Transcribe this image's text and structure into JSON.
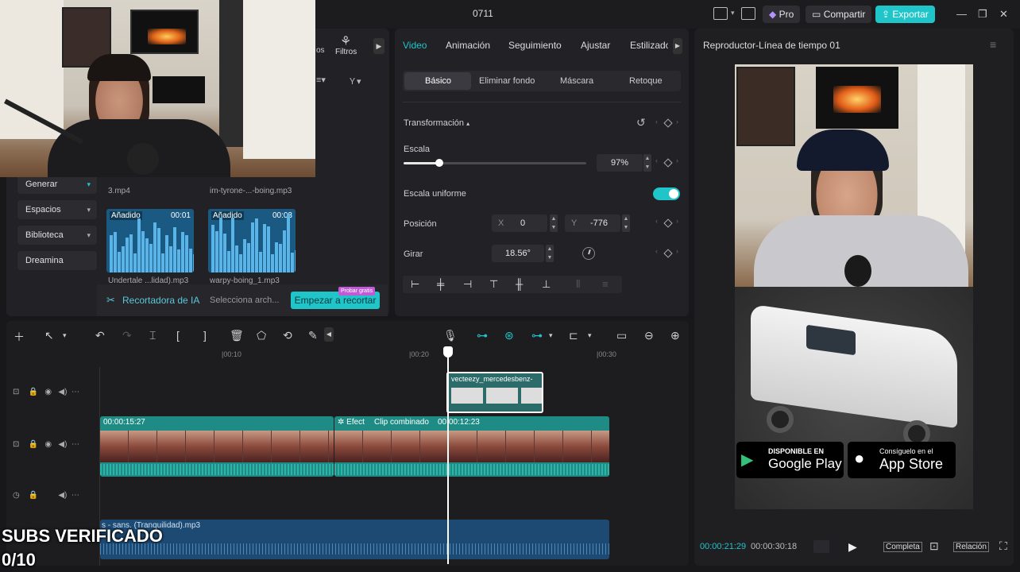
{
  "titlebar": {
    "title": "0711",
    "pro_label": "Pro",
    "share_label": "Compartir",
    "export_label": "Exportar"
  },
  "media_panel": {
    "tab_partial": "os",
    "tab_filters": "Filtros",
    "side_buttons": [
      "Generar",
      "Espacios",
      "Biblioteca",
      "Dreamina"
    ],
    "top_files": [
      "3.mp4",
      "im-tyrone-...-boing.mp3"
    ],
    "clips": [
      {
        "badge": "Añadido",
        "duration": "00:01",
        "name": "Undertale ...lidad).mp3"
      },
      {
        "badge": "Añadido",
        "duration": "00:03",
        "name": "warpy-boing_1.mp3"
      }
    ],
    "ai_cutter_label": "Recortadora de IA",
    "select_file": "Selecciona arch...",
    "start_cut": "Empezar a recortar",
    "free_badge": "Probar gratis"
  },
  "props": {
    "tabs": [
      "Video",
      "Animación",
      "Seguimiento",
      "Ajustar",
      "Estilizado"
    ],
    "subtabs": [
      "Básico",
      "Eliminar fondo",
      "Máscara",
      "Retoque"
    ],
    "transform_label": "Transformación",
    "scale_label": "Escala",
    "scale_value": "97%",
    "scale_fraction": 0.97,
    "uniform_label": "Escala uniforme",
    "position_label": "Posición",
    "x_label": "X",
    "x_value": "0",
    "y_label": "Y",
    "y_value": "-776",
    "rotate_label": "Girar",
    "rotate_value": "18.56°"
  },
  "player": {
    "title": "Reproductor-Línea de tiempo 01",
    "current_time": "00:00:21:29",
    "total_time": "00:00:30:18",
    "full_label": "Completa",
    "ratio_label": "Relación",
    "google_small": "DISPONIBLE EN",
    "google_big": "Google Play",
    "apple_small": "Consíguelo en el",
    "apple_big": "App Store"
  },
  "timeline": {
    "ruler": [
      "|00:10",
      "|00:20",
      "|00:30"
    ],
    "overlay_clip": "vecteezy_mercedesbenz-",
    "main_clip_time": "00:00:15:27",
    "effect_label": "Efect",
    "combined_label": "Clip combinado",
    "combined_time": "00:00:12:23",
    "audio_clip": "s - sans. (Tranquilidad).mp3"
  },
  "overlay": {
    "subs_line1": "SUBS VERIFICADO",
    "subs_line2": "0/10"
  },
  "colors": {
    "accent": "#20c5c9",
    "clip_green": "#1e8c84",
    "audio_blue": "#1d4a73"
  }
}
